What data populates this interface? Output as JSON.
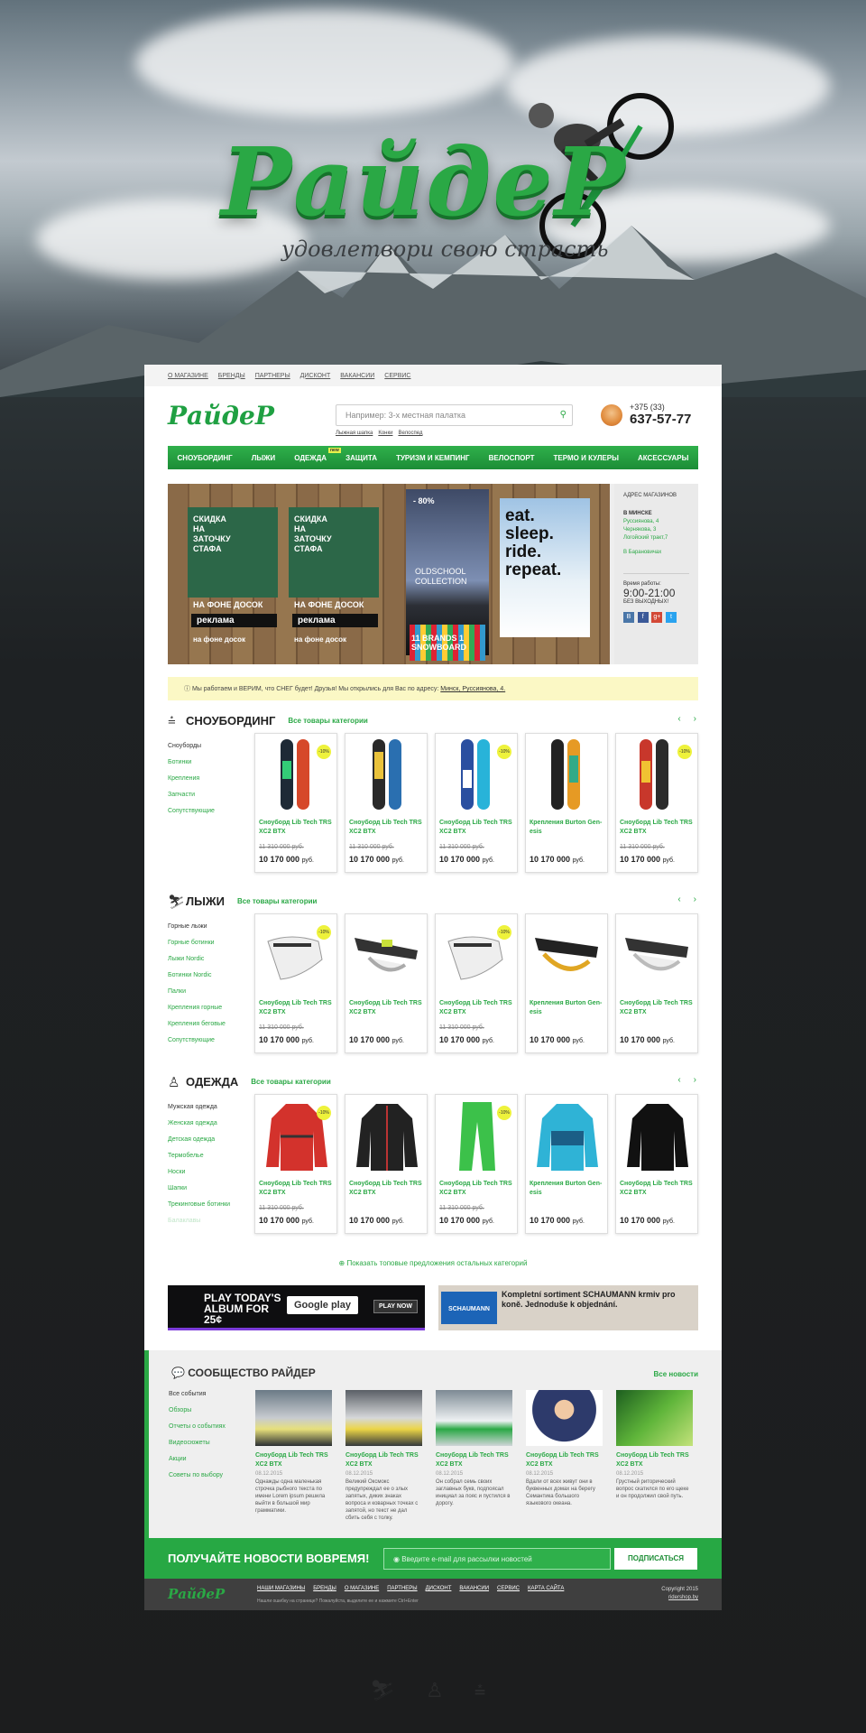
{
  "hero": {
    "logo": "РайдеР",
    "tagline": "удовлетвори свою страсть"
  },
  "topnav": [
    "О МАГАЗИНЕ",
    "БРЕНДЫ",
    "ПАРТНЕРЫ",
    "ДИСКОНТ",
    "ВАКАНСИИ",
    "СЕРВИС"
  ],
  "header": {
    "logo": "РайдеР",
    "search_placeholder": "Например: 3-х местная палатка",
    "search_hints": [
      "Лыжная шапка",
      "Конки",
      "Велоспед"
    ],
    "phone_code": "+375 (33)",
    "phone": "637-57-77"
  },
  "mainnav": [
    {
      "label": "СНОУБОРДИНГ"
    },
    {
      "label": "ЛЫЖИ"
    },
    {
      "label": "ОДЕЖДА",
      "badge": "new"
    },
    {
      "label": "ЗАЩИТА"
    },
    {
      "label": "ТУРИЗМ И КЕМПИНГ"
    },
    {
      "label": "ВЕЛОСПОРТ"
    },
    {
      "label": "ТЕРМО И КУЛЕРЫ"
    },
    {
      "label": "АКСЕССУАРЫ"
    }
  ],
  "promo": {
    "ad1": {
      "title": "СКИДКА НА ЗАТОЧКУ СТАФА",
      "mini": "НА ФОНЕ ДОСОК",
      "tag": "реклама",
      "bottom": "на фоне досок"
    },
    "ad2": {
      "title": "СКИДКА НА ЗАТОЧКУ СТАФА",
      "mini": "НА ФОНЕ ДОСОК",
      "tag": "реклама",
      "bottom": "на фоне досок"
    },
    "ad3": {
      "badge": "- 80%",
      "title": "OLDSCHOOL COLLECTION",
      "brands": "11 BRANDS 1 SNOWBOARD"
    },
    "ad4": {
      "title": "eat. sleep. ride. repeat."
    },
    "address": {
      "title": "АДРЕС МАГАЗИНОВ",
      "city1": "В МИНСКЕ",
      "shops": [
        "Руссиянова, 4",
        "Чернякова, 3",
        "Логойский тракт,7"
      ],
      "city2": "В Барановичах",
      "hours_label": "Время работы:",
      "hours": "9:00-21:00",
      "days_off": "БЕЗ ВЫХОДНЫХ!",
      "social": [
        "В",
        "f",
        "g+",
        "t"
      ]
    }
  },
  "notice": {
    "text": "Мы работаем и ВЕРИМ, что СНЕГ будет!   Друзья! Мы открылись для Вас по адресу:",
    "link": "Минск, Руссиянова, 4."
  },
  "categories": [
    {
      "title": "СНОУБОРДИНГ",
      "all": "Все товары категории",
      "subs": [
        "Сноуборды",
        "Ботинки",
        "Крепления",
        "Запчасти",
        "Сопутствующие"
      ],
      "products": [
        {
          "name": "Сноуборд Lib Tech TRS XC2 BTX",
          "old": "11 310 000 руб.",
          "price": "10 170 000",
          "badge": "-10%"
        },
        {
          "name": "Сноуборд Lib Tech TRS XC2 BTX",
          "old": "11 310 000 руб.",
          "price": "10 170 000",
          "badge": ""
        },
        {
          "name": "Сноуборд Lib Tech TRS XC2 BTX",
          "old": "11 310 000 руб.",
          "price": "10 170 000",
          "badge": "-10%"
        },
        {
          "name": "Крепления Burton Gen-esis",
          "old": "",
          "price": "10 170 000",
          "badge": ""
        },
        {
          "name": "Сноуборд Lib Tech TRS XC2 BTX",
          "old": "11 310 000 руб.",
          "price": "10 170 000",
          "badge": "-10%"
        }
      ]
    },
    {
      "title": "ЛЫЖИ",
      "all": "Все товары категории",
      "subs": [
        "Горные лыжи",
        "Горные ботинки",
        "Лыжи Nordic",
        "Ботинки Nordic",
        "Палки",
        "Крепления горные",
        "Крепления беговые",
        "Сопутствующие"
      ],
      "products": [
        {
          "name": "Сноуборд Lib Tech TRS XC2 BTX",
          "old": "11 310 000 руб.",
          "price": "10 170 000",
          "badge": "-10%"
        },
        {
          "name": "Сноуборд Lib Tech TRS XC2 BTX",
          "old": "",
          "price": "10 170 000",
          "badge": ""
        },
        {
          "name": "Сноуборд Lib Tech TRS XC2 BTX",
          "old": "11 310 000 руб.",
          "price": "10 170 000",
          "badge": "-10%"
        },
        {
          "name": "Крепления Burton Gen-esis",
          "old": "",
          "price": "10 170 000",
          "badge": ""
        },
        {
          "name": "Сноуборд Lib Tech TRS XC2 BTX",
          "old": "",
          "price": "10 170 000",
          "badge": ""
        }
      ]
    },
    {
      "title": "ОДЕЖДА",
      "all": "Все товары категории",
      "subs": [
        "Мужская одежда",
        "Женская одежда",
        "Детская одежда",
        "Термобелье",
        "Носки",
        "Шапки",
        "Трекинговые ботинки",
        "Балаклавы"
      ],
      "products": [
        {
          "name": "Сноуборд Lib Tech TRS XC2 BTX",
          "old": "11 310 000 руб.",
          "price": "10 170 000",
          "badge": "-10%"
        },
        {
          "name": "Сноуборд Lib Tech TRS XC2 BTX",
          "old": "",
          "price": "10 170 000",
          "badge": ""
        },
        {
          "name": "Сноуборд Lib Tech TRS XC2 BTX",
          "old": "11 310 000 руб.",
          "price": "10 170 000",
          "badge": "-10%"
        },
        {
          "name": "Крепления Burton Gen-esis",
          "old": "",
          "price": "10 170 000",
          "badge": ""
        },
        {
          "name": "Сноуборд Lib Tech TRS XC2 BTX",
          "old": "",
          "price": "10 170 000",
          "badge": ""
        }
      ]
    }
  ],
  "currency": "руб.",
  "more_link": "Показать топовые предложения остальных категорий",
  "banners": {
    "b1_text": "PLAY TODAY'S ALBUM FOR 25¢",
    "b1_gp": "Google play",
    "b1_btn": "PLAY NOW",
    "b2_logo": "SCHAUMANN",
    "b2_text": "Kompletní sortiment SCHAUMANN krmiv pro koně. Jednoduše k objednání."
  },
  "community": {
    "title": "СООБЩЕСТВО РАЙДЕР",
    "all": "Все новости",
    "subs": [
      "Все события",
      "Обзоры",
      "Отчеты о событиях",
      "Видеосюжеты",
      "Акции",
      "Советы по выбору"
    ],
    "news": [
      {
        "title": "Сноуборд Lib Tech TRS XC2 BTX",
        "date": "08.12.2015",
        "text": "Однажды одна маленькая строчка рыбного текста по имени Lorem ipsum решила выйти в большой мир грамматики."
      },
      {
        "title": "Сноуборд Lib Tech TRS XC2 BTX",
        "date": "08.12.2015",
        "text": "Великий Оксмокс предупреждал ее о злых запятых, диких знаках вопроса и коварных точках с запятой, но текст не дал сбить себя с толку."
      },
      {
        "title": "Сноуборд Lib Tech TRS XC2 BTX",
        "date": "08.12.2015",
        "text": "Он собрал семь своих заглавных букв, подпоясал инициал за пояс и пустился в дорогу."
      },
      {
        "title": "Сноуборд Lib Tech TRS XC2 BTX",
        "date": "08.12.2015",
        "text": "Вдали от всех живут они в буквенных домах на берегу Семантика большого языкового океана."
      },
      {
        "title": "Сноуборд Lib Tech TRS XC2 BTX",
        "date": "08.12.2015",
        "text": "Грустный риторический вопрос скатился по его щеке и он продолжил свой путь."
      }
    ]
  },
  "subscribe": {
    "title": "ПОЛУЧАЙТЕ НОВОСТИ ВОВРЕМЯ!",
    "placeholder": "Введите e-mail для рассылки новостей",
    "button": "ПОДПИСАТЬСЯ"
  },
  "footer": {
    "logo": "РайдеР",
    "links": [
      "НАШИ МАГАЗИНЫ",
      "БРЕНДЫ",
      "О МАГАЗИНЕ",
      "ПАРТНЕРЫ",
      "ДИСКОНТ",
      "ВАКАНСИИ",
      "СЕРВИС",
      "КАРТА САЙТА"
    ],
    "note": "Нашли ошибку на странице? Пожалуйста, выделите ее и нажмите Ctrl+Enter",
    "copyright": "Copyright 2015",
    "site": "ridershop.by"
  },
  "colors": {
    "accent": "#2aa845",
    "accent_dark": "#1c8d36",
    "notice_bg": "#fbf8c5",
    "sale_badge": "#eef23b"
  }
}
